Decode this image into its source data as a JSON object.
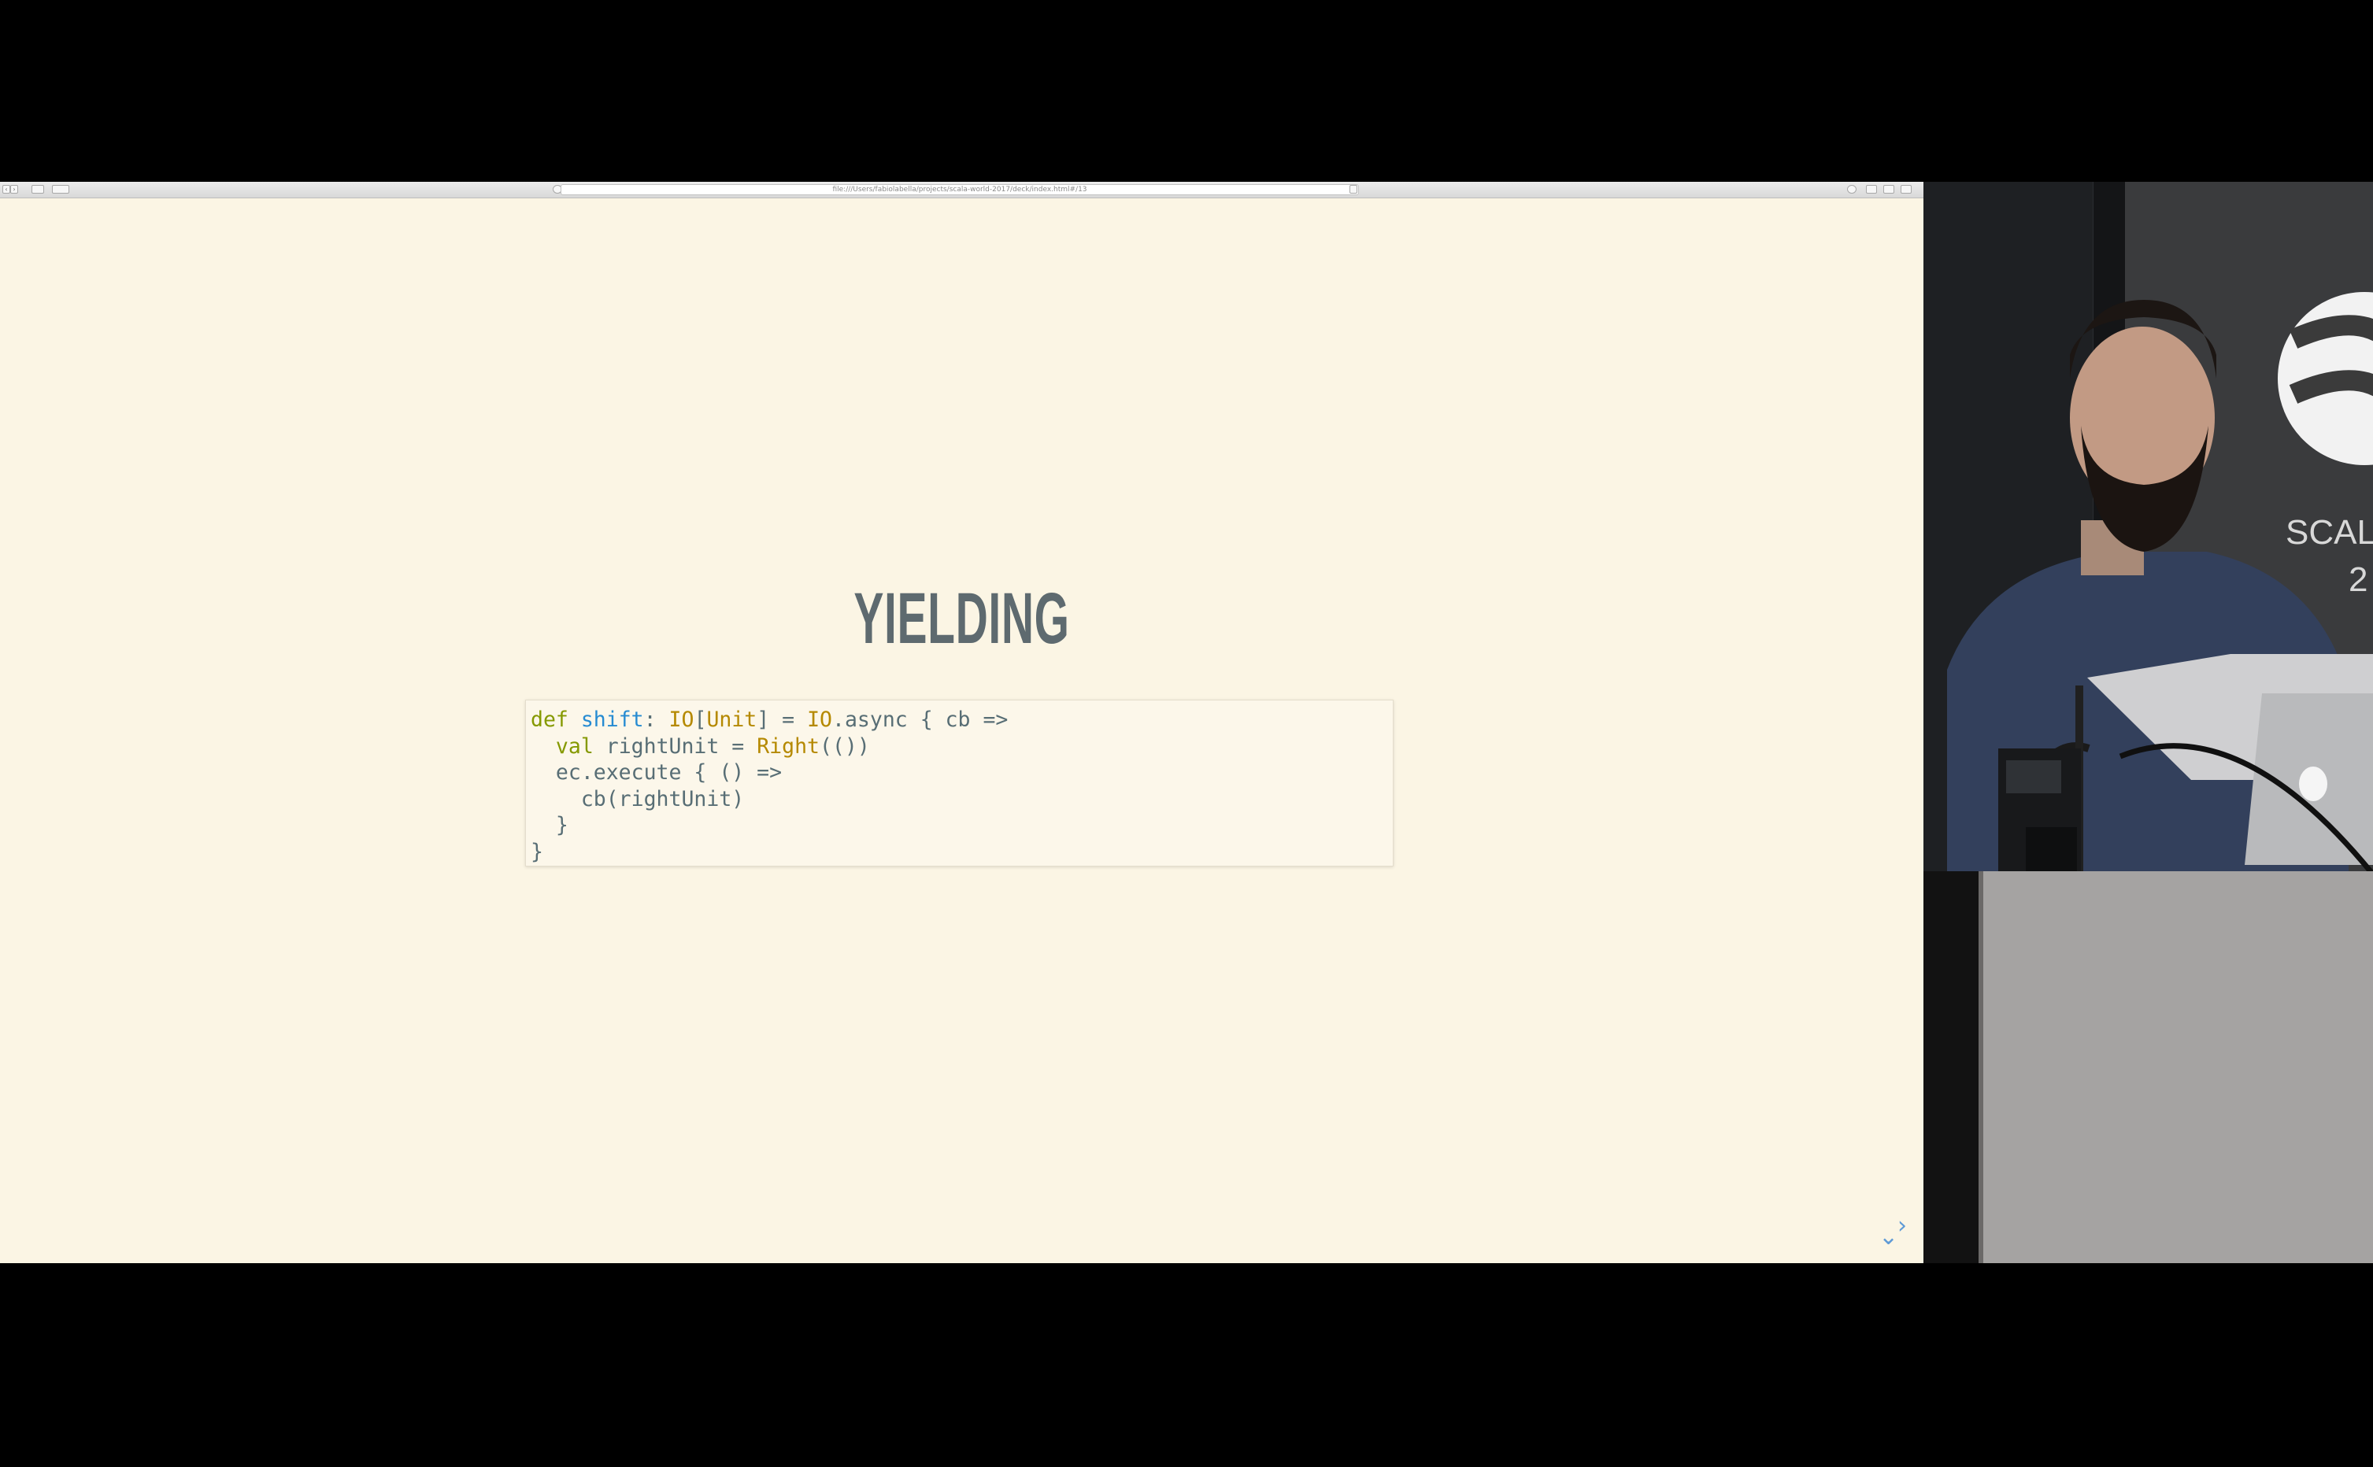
{
  "browser": {
    "url": "file:///Users/fabiolabella/projects/scala-world-2017/deck/index.html#/13"
  },
  "slide": {
    "title": "YIELDING",
    "code": {
      "line1": {
        "kw": "def",
        "name": "shift",
        "p1": ": ",
        "t1": "IO",
        "p2": "[",
        "t2": "Unit",
        "p3": "] = ",
        "t3": "IO",
        "p4": ".async { cb =>"
      },
      "line2": {
        "indent": "  ",
        "kw": "val",
        "p1": " rightUnit = ",
        "t1": "Right",
        "p2": "(())"
      },
      "line3": "  ec.execute { () =>",
      "line4": "    cb(rightUnit)",
      "line5": "  }",
      "line6": "}"
    }
  },
  "nav": {
    "right": "›",
    "down": "⌄"
  },
  "video": {
    "backdrop_text": "SCALA",
    "backdrop_year": "2"
  },
  "colors": {
    "slide_background": "#fbf5e4",
    "title": "#5e6a6f",
    "keyword": "#859900",
    "function_name": "#268bd2",
    "type": "#b58900",
    "code_text": "#586e75",
    "nav_arrow": "#5e9ad6"
  }
}
